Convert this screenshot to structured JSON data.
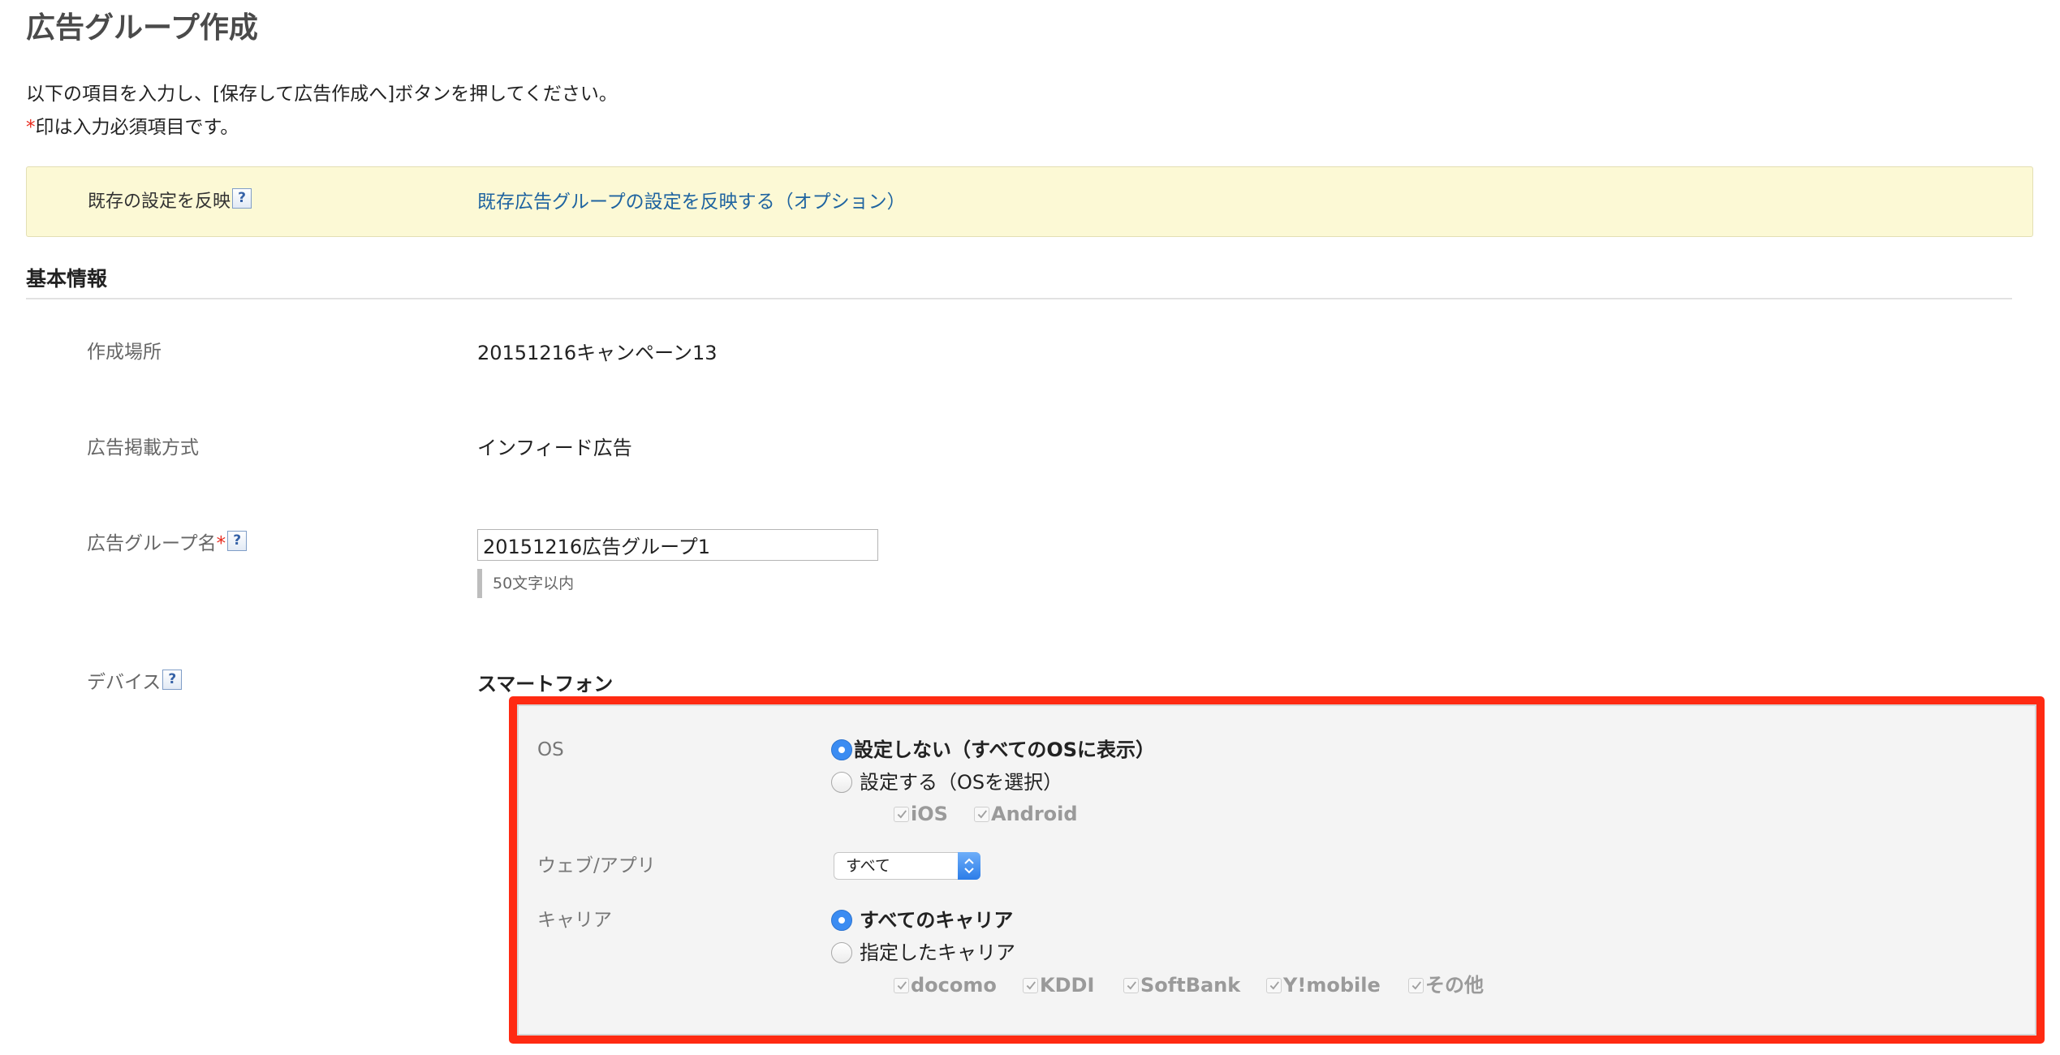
{
  "page": {
    "title": "広告グループ作成",
    "intro_line1": "以下の項目を入力し、[保存して広告作成へ]ボタンを押してください。",
    "required_mark": "*",
    "intro_line2": "印は入力必須項目です。"
  },
  "existing_settings": {
    "label": "既存の設定を反映",
    "help_glyph": "?",
    "link": "既存広告グループの設定を反映する（オプション）"
  },
  "basic_info": {
    "heading": "基本情報",
    "location": {
      "label": "作成場所",
      "value": "20151216キャンペーン13"
    },
    "placement": {
      "label": "広告掲載方式",
      "value": "インフィード広告"
    },
    "ad_group_name": {
      "label": "広告グループ名",
      "required_mark": "*",
      "help_glyph": "?",
      "value": "20151216広告グループ1",
      "hint": "50文字以内"
    },
    "device": {
      "label": "デバイス",
      "help_glyph": "?",
      "value": "スマートフォン"
    }
  },
  "device_settings": {
    "os": {
      "label": "OS",
      "options": [
        {
          "label": "設定しない（すべてのOSに表示）",
          "selected": true
        },
        {
          "label": "設定する（OSを選択）",
          "selected": false
        }
      ],
      "checkboxes": [
        {
          "label": "iOS",
          "checked": true,
          "disabled": true
        },
        {
          "label": "Android",
          "checked": true,
          "disabled": true
        }
      ]
    },
    "web_app": {
      "label": "ウェブ/アプリ",
      "selected": "すべて"
    },
    "carrier": {
      "label": "キャリア",
      "options": [
        {
          "label": "すべてのキャリア",
          "selected": true
        },
        {
          "label": "指定したキャリア",
          "selected": false
        }
      ],
      "checkboxes": [
        {
          "label": "docomo",
          "checked": true,
          "disabled": true
        },
        {
          "label": "KDDI",
          "checked": true,
          "disabled": true
        },
        {
          "label": "SoftBank",
          "checked": true,
          "disabled": true
        },
        {
          "label": "Y!mobile",
          "checked": true,
          "disabled": true
        },
        {
          "label": "その他",
          "checked": true,
          "disabled": true
        }
      ]
    }
  },
  "icons": {
    "help": "help-icon",
    "radio": "radio-icon",
    "checkbox": "check-icon",
    "select": "chevron-up-down-icon"
  },
  "colors": {
    "highlight_border": "#ff2a12",
    "notice_background": "#fcf9d5",
    "link": "#1f64a0",
    "radio_selected": "#3b8cf2",
    "required_mark": "#e8291c"
  }
}
